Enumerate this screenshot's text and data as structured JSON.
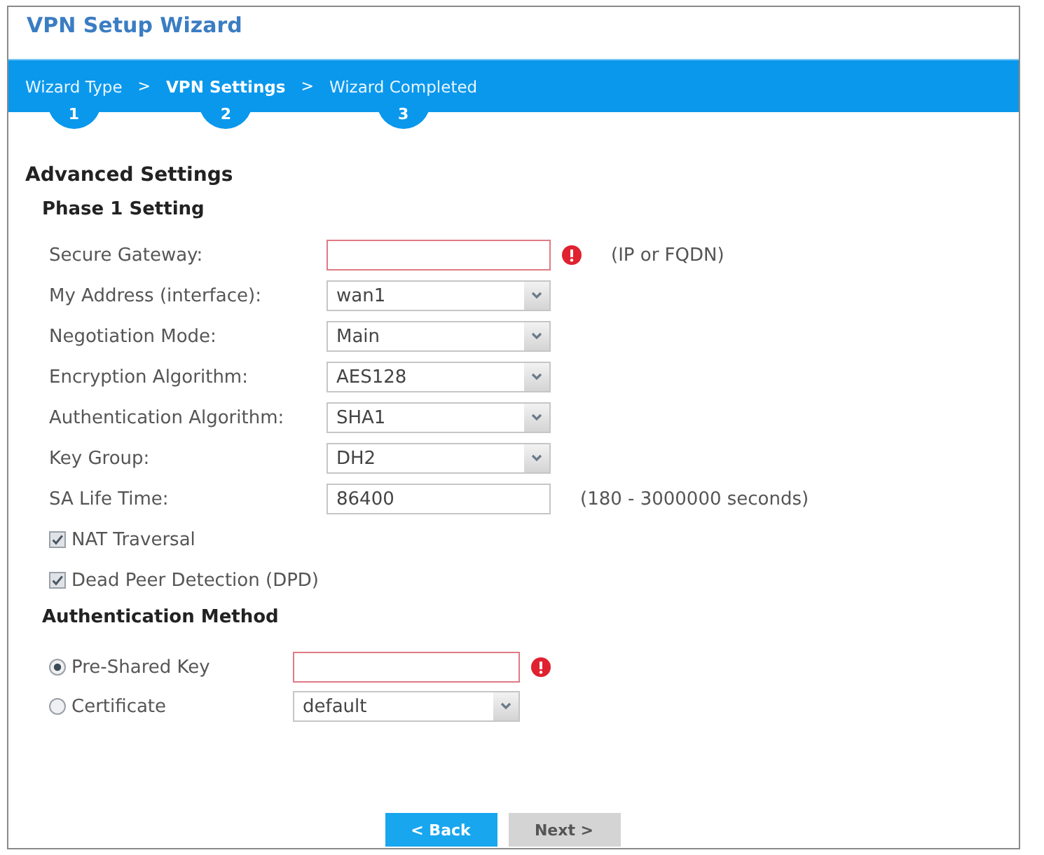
{
  "window": {
    "title": "VPN Setup Wizard"
  },
  "steps": [
    {
      "label": "Wizard Type",
      "number": "1",
      "selected": false
    },
    {
      "separator": ">",
      "label": "VPN Settings",
      "number": "2",
      "selected": true
    },
    {
      "separator": ">",
      "label": "Wizard Completed",
      "number": "3",
      "selected": false
    }
  ],
  "heading": "Advanced Settings",
  "phase1": {
    "title": "Phase 1 Setting",
    "fields": [
      {
        "kind": "text",
        "label": "Secure Gateway:",
        "error": true,
        "hint": "(IP or FQDN)"
      },
      {
        "kind": "select",
        "label": "My Address (interface):",
        "value": "wan1",
        "error": false
      },
      {
        "kind": "select",
        "label": "Negotiation Mode:",
        "value": "Main",
        "error": false
      },
      {
        "kind": "select",
        "label": "Encryption Algorithm:",
        "value": "AES128",
        "error": false
      },
      {
        "kind": "select",
        "label": "Authentication Algorithm:",
        "value": "SHA1",
        "error": false
      },
      {
        "kind": "select",
        "label": "Key Group:",
        "value": "DH2",
        "error": false
      },
      {
        "kind": "text",
        "label": "SA Life Time:",
        "value": "86400",
        "error": false,
        "hint": "(180 - 3000000 seconds)"
      }
    ],
    "options": [
      {
        "label": "NAT Traversal",
        "checked": true
      },
      {
        "label": "Dead Peer Detection (DPD)",
        "checked": true
      }
    ]
  },
  "auth": {
    "title": "Authentication Method",
    "methods": [
      {
        "kind": "text",
        "label": "Pre-Shared Key",
        "selected": true,
        "error": true
      },
      {
        "kind": "select",
        "label": "Certificate",
        "selected": false,
        "value": "default",
        "error": false
      }
    ]
  },
  "buttons": [
    {
      "label": "< Back",
      "disabled": false
    },
    {
      "label": "Next >",
      "disabled": true
    }
  ]
}
